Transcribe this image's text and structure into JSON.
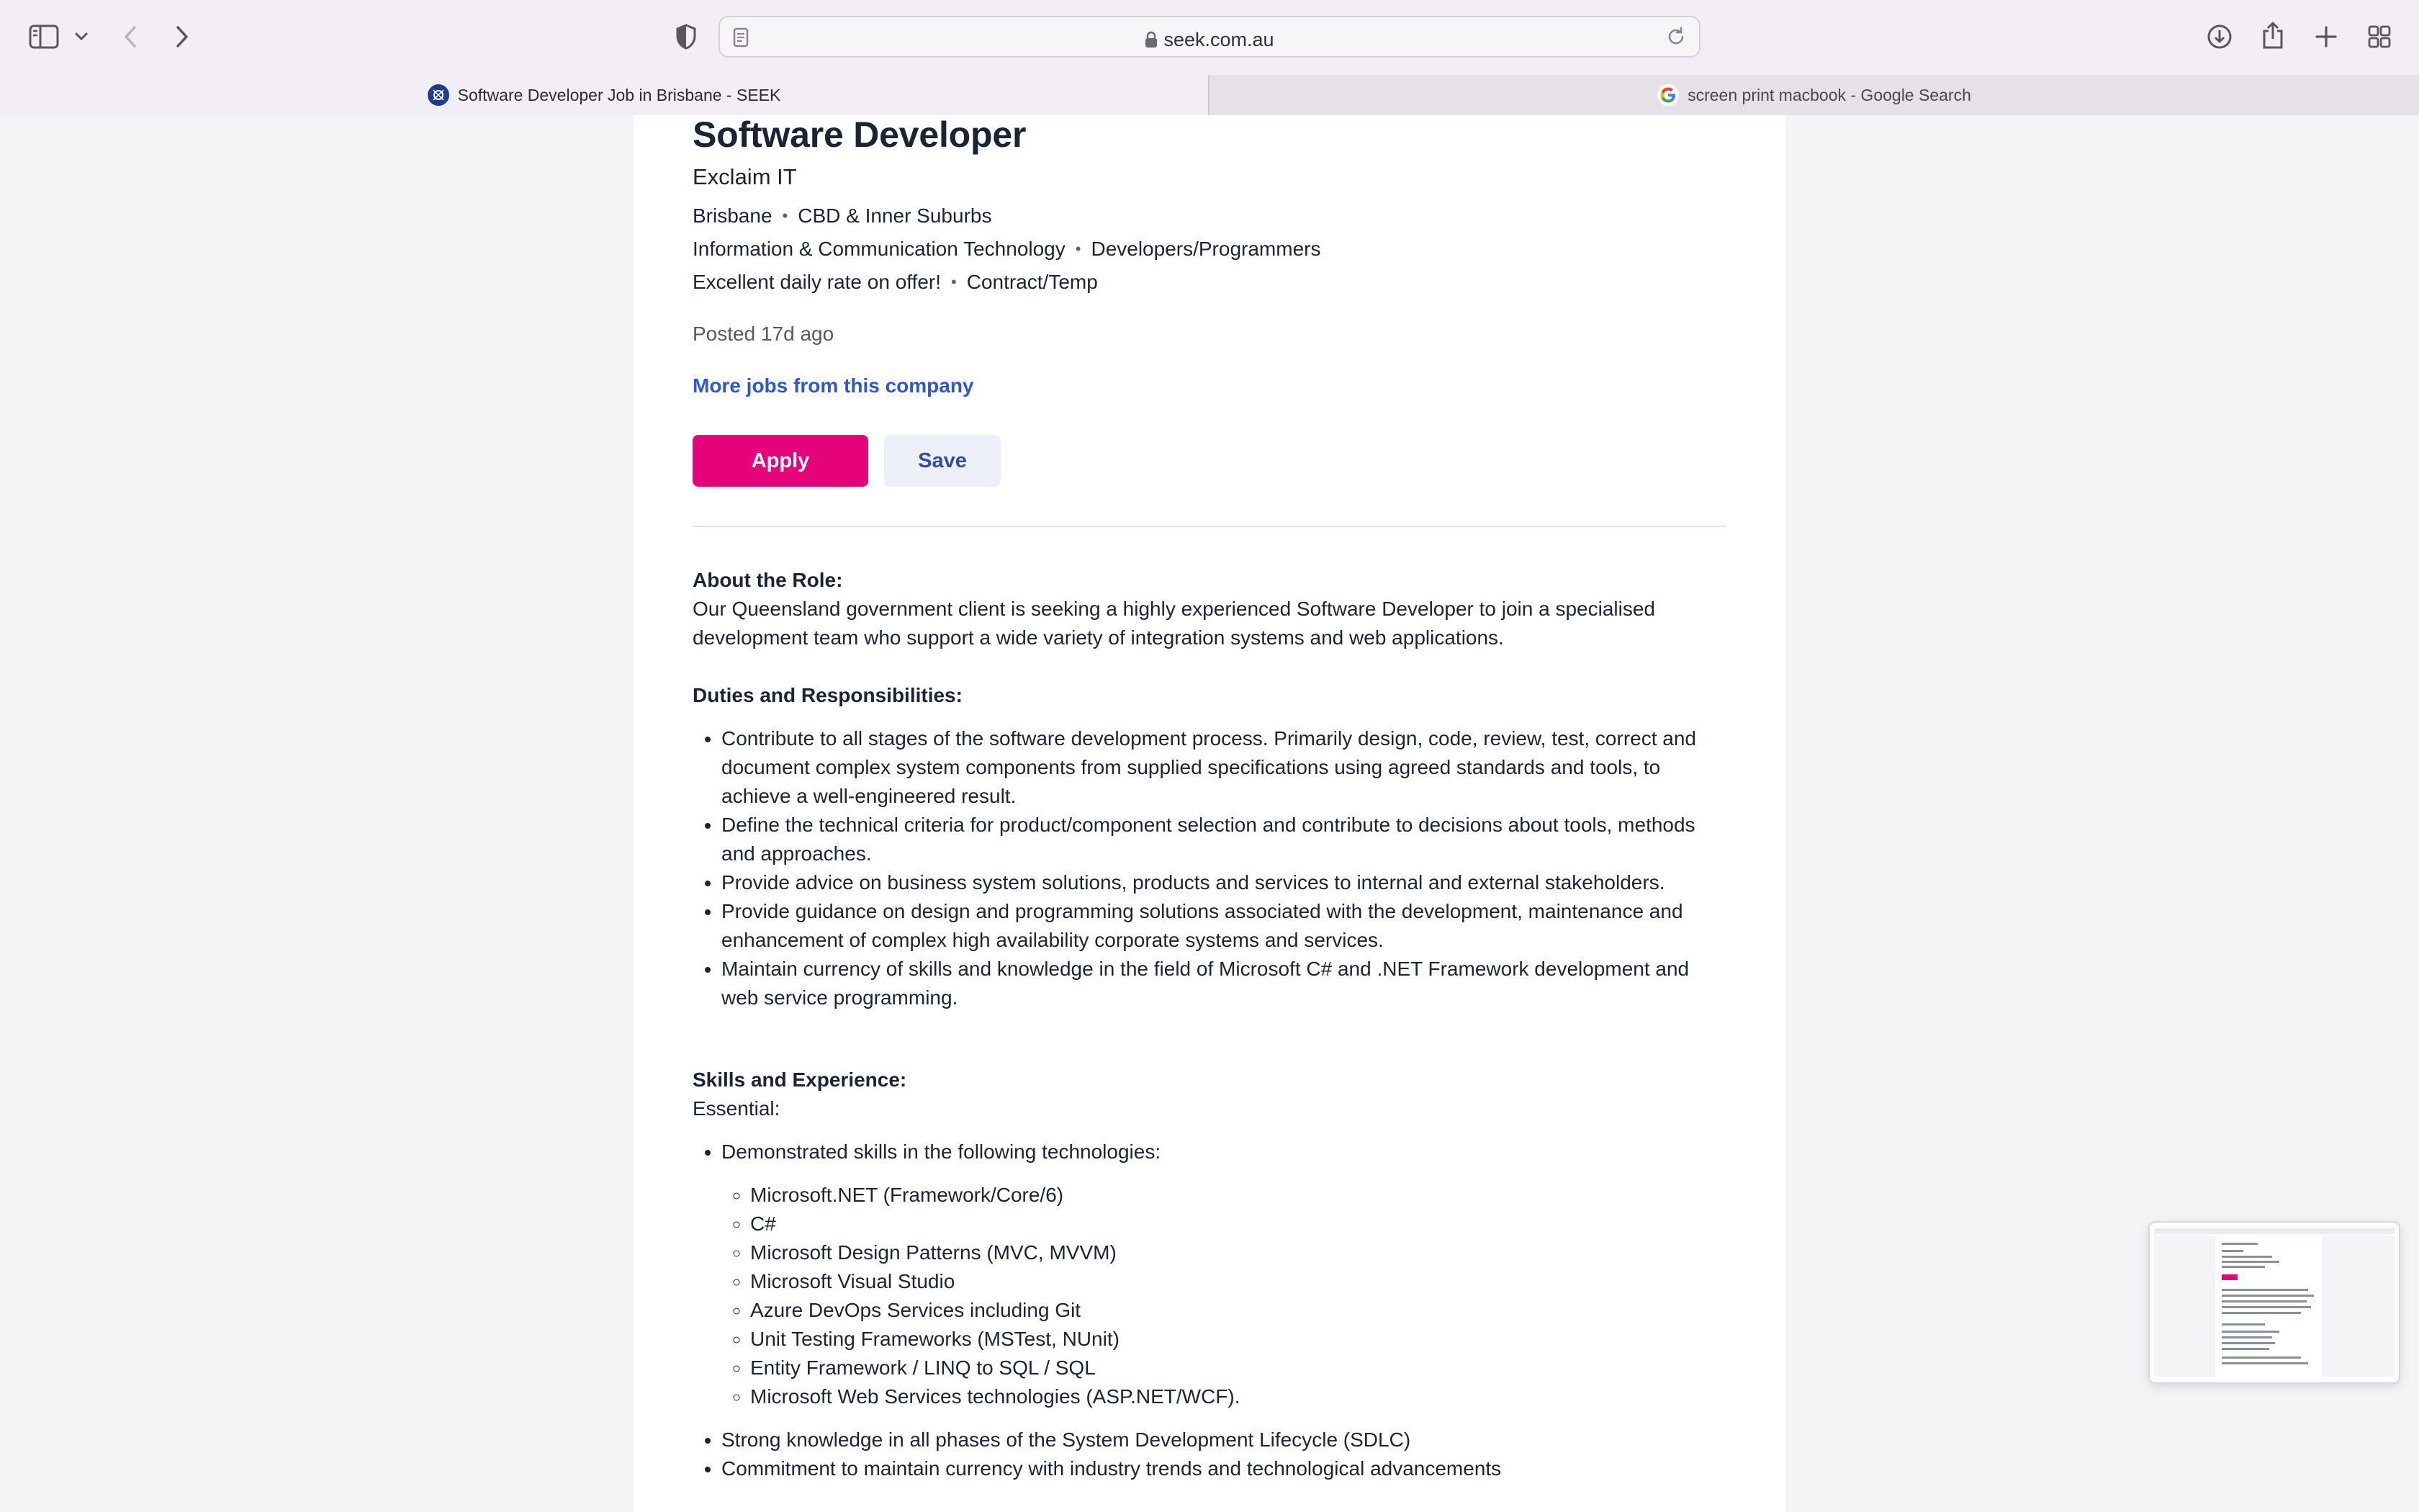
{
  "browser": {
    "url": "seek.com.au",
    "tabs": [
      {
        "label": "Software Developer Job in Brisbane - SEEK",
        "active": true
      },
      {
        "label": "screen print macbook - Google Search",
        "active": false
      }
    ],
    "icons": [
      "sidebar-icon",
      "chevron-down-icon",
      "back-icon",
      "forward-icon",
      "shield-icon",
      "reader-icon",
      "lock-icon",
      "reload-icon",
      "download-icon",
      "share-icon",
      "new-tab-icon",
      "tab-overview-icon"
    ]
  },
  "job": {
    "title": "Software Developer",
    "company": "Exclaim IT",
    "location": "Brisbane",
    "area": "CBD & Inner Suburbs",
    "classification": "Information & Communication Technology",
    "subclassification": "Developers/Programmers",
    "salary": "Excellent daily rate on offer!",
    "work_type": "Contract/Temp",
    "posted": "Posted 17d ago",
    "more_jobs": "More jobs from this company",
    "apply_label": "Apply",
    "save_label": "Save"
  },
  "description": {
    "about_heading": "About the Role:",
    "about_text": "Our Queensland government client is seeking a highly experienced Software Developer to join a specialised development team who support a wide variety of integration systems and web applications.",
    "duties_heading": "Duties and Responsibilities:",
    "duties": [
      "Contribute to all stages of the software development process. Primarily design, code, review, test, correct and document complex system components from supplied specifications using agreed standards and tools, to achieve a well-engineered result.",
      "Define the technical criteria for product/component selection and contribute to decisions about tools, methods and approaches.",
      "Provide advice on business system solutions, products and services to internal and external stakeholders.",
      "Provide guidance on design and programming solutions associated with the development, maintenance and enhancement of complex high availability corporate systems and services.",
      "Maintain currency of skills and knowledge in the field of Microsoft C# and .NET Framework development and web service programming."
    ],
    "skills_heading": "Skills and Experience:",
    "essential_label": "Essential:",
    "tech_intro": "Demonstrated skills in the following technologies:",
    "technologies": [
      "Microsoft.NET (Framework/Core/6)",
      "C#",
      "Microsoft Design Patterns (MVC, MVVM)",
      "Microsoft Visual Studio",
      "Azure DevOps Services including Git",
      "Unit Testing Frameworks (MSTest, NUnit)",
      "Entity Framework / LINQ to SQL / SQL",
      "Microsoft Web Services technologies (ASP.NET/WCF)."
    ],
    "other_skills": [
      "Strong knowledge in all phases of the System Development Lifecycle (SDLC)",
      "Commitment to maintain currency with industry trends and technological advancements"
    ]
  },
  "colors": {
    "apply": "#e60278",
    "link": "#2e58d1",
    "save_bg": "#eef0f9"
  }
}
